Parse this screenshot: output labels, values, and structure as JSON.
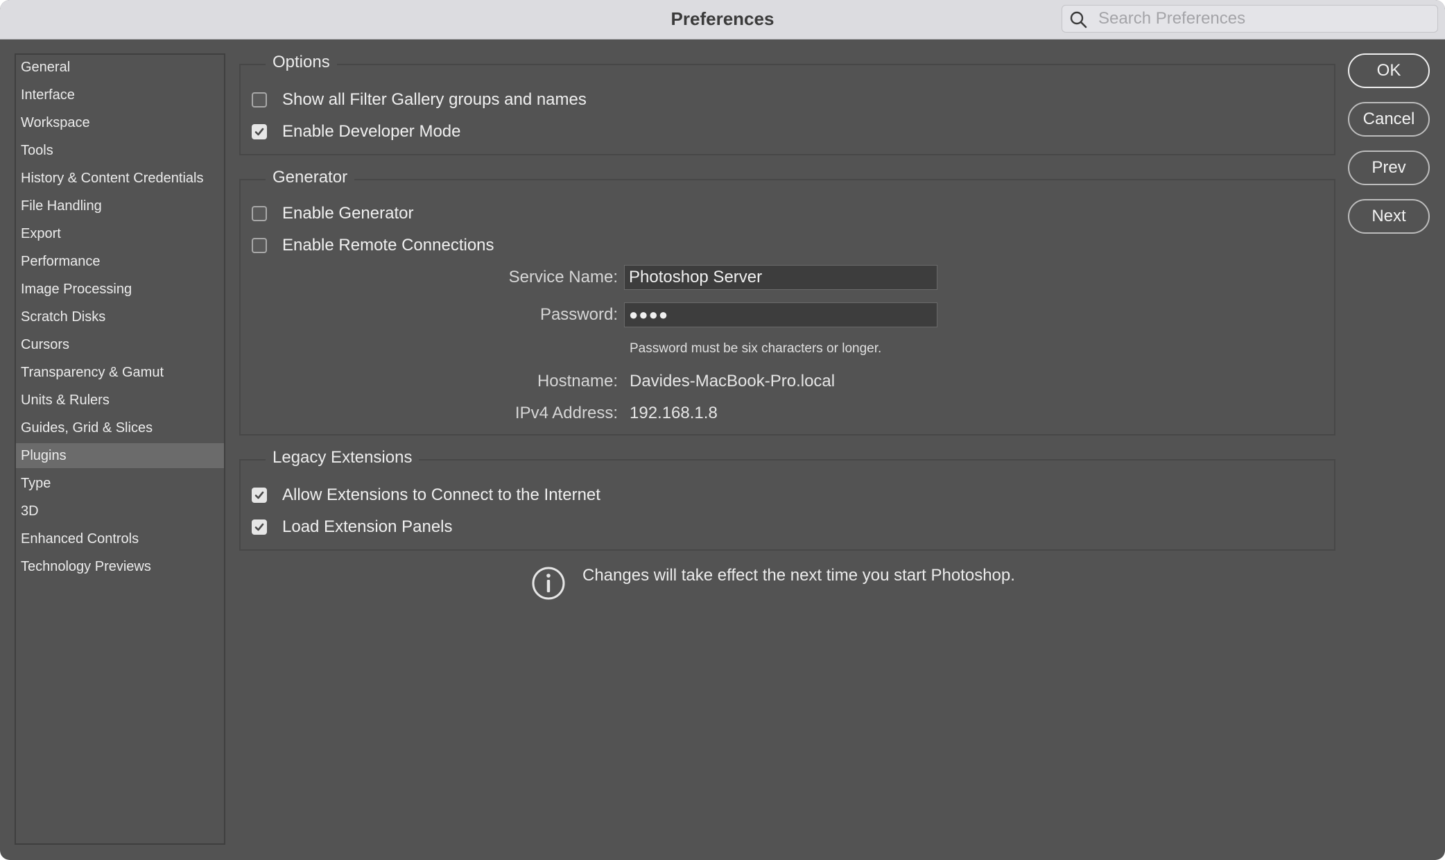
{
  "window": {
    "title": "Preferences"
  },
  "search": {
    "placeholder": "Search Preferences",
    "icon": "search-icon"
  },
  "sidebar": {
    "items": [
      {
        "label": "General"
      },
      {
        "label": "Interface"
      },
      {
        "label": "Workspace"
      },
      {
        "label": "Tools"
      },
      {
        "label": "History & Content Credentials"
      },
      {
        "label": "File Handling"
      },
      {
        "label": "Export"
      },
      {
        "label": "Performance"
      },
      {
        "label": "Image Processing"
      },
      {
        "label": "Scratch Disks"
      },
      {
        "label": "Cursors"
      },
      {
        "label": "Transparency & Gamut"
      },
      {
        "label": "Units & Rulers"
      },
      {
        "label": "Guides, Grid & Slices"
      },
      {
        "label": "Plugins",
        "selected": true
      },
      {
        "label": "Type"
      },
      {
        "label": "3D"
      },
      {
        "label": "Enhanced Controls"
      },
      {
        "label": "Technology Previews"
      }
    ]
  },
  "options": {
    "title": "Options",
    "show_filter_gallery": {
      "label": "Show all Filter Gallery groups and names",
      "checked": false
    },
    "developer_mode": {
      "label": "Enable Developer Mode",
      "checked": true
    }
  },
  "generator": {
    "title": "Generator",
    "enable_generator": {
      "label": "Enable Generator",
      "checked": false
    },
    "remote_connections": {
      "label": "Enable Remote Connections",
      "checked": false
    },
    "service_name_label": "Service Name:",
    "service_name_value": "Photoshop Server",
    "password_label": "Password:",
    "password_value": "●●●●",
    "password_hint": "Password must be six characters or longer.",
    "hostname_label": "Hostname:",
    "hostname_value": "Davides-MacBook-Pro.local",
    "ipv4_label": "IPv4 Address:",
    "ipv4_value": "192.168.1.8"
  },
  "legacy": {
    "title": "Legacy Extensions",
    "allow_internet": {
      "label": "Allow Extensions to Connect to the Internet",
      "checked": true
    },
    "load_panels": {
      "label": "Load Extension Panels",
      "checked": true
    }
  },
  "buttons": {
    "ok": "OK",
    "cancel": "Cancel",
    "prev": "Prev",
    "next": "Next"
  },
  "notice": {
    "icon": "info-icon",
    "text": "Changes will take effect the next time you start Photoshop."
  },
  "colors": {
    "window_bg": "#535353",
    "titlebar_bg": "#dcdce0",
    "selected_item_bg": "#6b6b6b",
    "text": "#ececec"
  }
}
